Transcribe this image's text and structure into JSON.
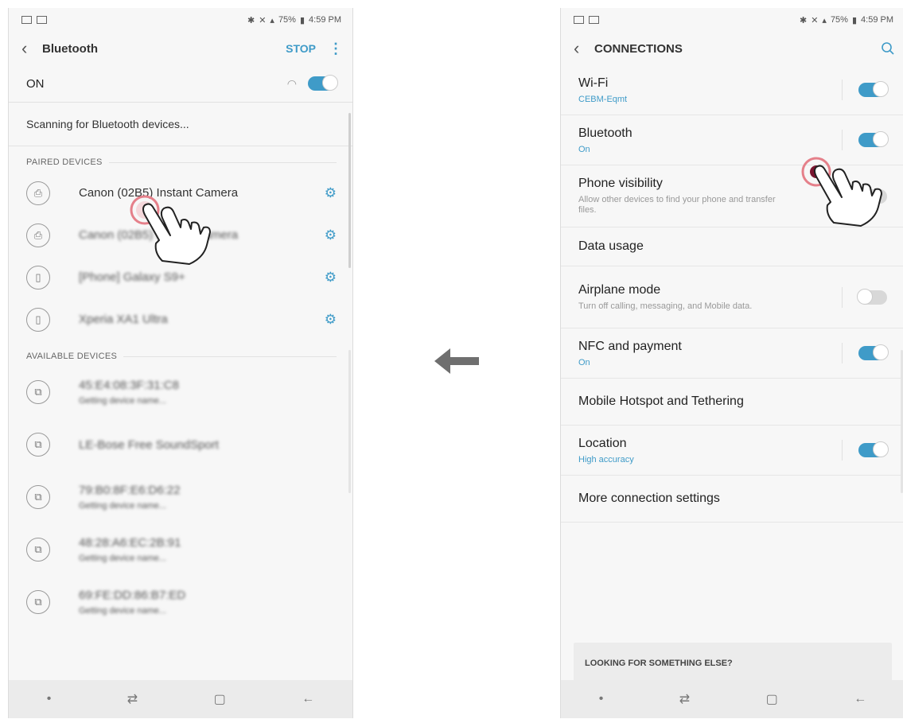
{
  "status_bar": {
    "battery": "75%",
    "time": "4:59 PM"
  },
  "left": {
    "title": "Bluetooth",
    "stop_label": "STOP",
    "on_label": "ON",
    "scanning_text": "Scanning for Bluetooth devices...",
    "paired_header": "PAIRED DEVICES",
    "available_header": "AVAILABLE DEVICES",
    "paired": [
      {
        "name": "Canon (02B5) Instant Camera",
        "icon": "printer-icon"
      },
      {
        "name": "Canon (02B5) Instant Camera",
        "icon": "printer-icon"
      },
      {
        "name": "[Phone] Galaxy S9+",
        "icon": "phone-icon"
      },
      {
        "name": "Xperia XA1 Ultra",
        "icon": "phone-icon"
      }
    ],
    "available": [
      {
        "name": "45:E4:08:3F:31:C8",
        "sub": "Getting device name..."
      },
      {
        "name": "LE-Bose Free SoundSport",
        "sub": ""
      },
      {
        "name": "79:B0:8F:E6:D6:22",
        "sub": "Getting device name..."
      },
      {
        "name": "48:28:A6:EC:2B:91",
        "sub": "Getting device name..."
      },
      {
        "name": "69:FE:DD:86:B7:ED",
        "sub": "Getting device name..."
      }
    ]
  },
  "right": {
    "title": "CONNECTIONS",
    "items": [
      {
        "title": "Wi-Fi",
        "sub": "CEBM-Eqmt",
        "sub_style": "blue",
        "toggle": "on"
      },
      {
        "title": "Bluetooth",
        "sub": "On",
        "sub_style": "blue",
        "toggle": "on"
      },
      {
        "title": "Phone visibility",
        "sub": "Allow other devices to find your phone and transfer files.",
        "sub_style": "grey",
        "toggle": "off"
      },
      {
        "title": "Data usage",
        "sub": "",
        "sub_style": "",
        "toggle": "none"
      },
      {
        "title": "Airplane mode",
        "sub": "Turn off calling, messaging, and Mobile data.",
        "sub_style": "grey",
        "toggle": "off"
      },
      {
        "title": "NFC and payment",
        "sub": "On",
        "sub_style": "blue",
        "toggle": "on"
      },
      {
        "title": "Mobile Hotspot and Tethering",
        "sub": "",
        "sub_style": "",
        "toggle": "none"
      },
      {
        "title": "Location",
        "sub": "High accuracy",
        "sub_style": "blue",
        "toggle": "on"
      },
      {
        "title": "More connection settings",
        "sub": "",
        "sub_style": "",
        "toggle": "none"
      }
    ],
    "looking_label": "LOOKING FOR SOMETHING ELSE?"
  },
  "colors": {
    "accent": "#3f9bc8",
    "tap_ring": "#e5808a",
    "arrow": "#6f6f6f"
  }
}
